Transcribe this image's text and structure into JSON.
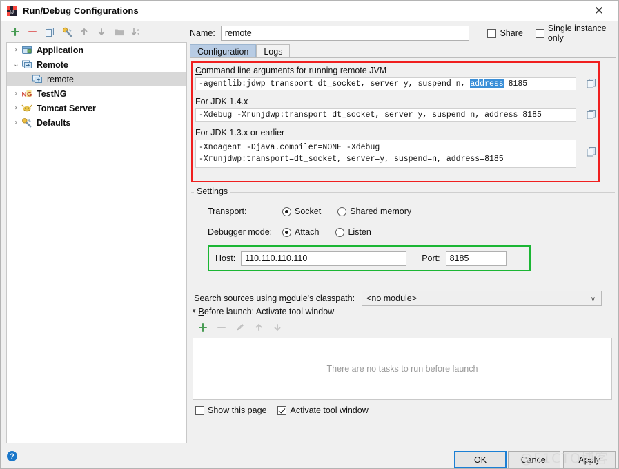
{
  "window": {
    "title": "Run/Debug Configurations",
    "icon": "intellij-idea-icon",
    "close_label": "✕"
  },
  "toolbar": {
    "buttons": [
      {
        "name": "add-button",
        "glyph": "+",
        "color": "#499c54"
      },
      {
        "name": "remove-button",
        "glyph": "−",
        "color": "#d9534f"
      },
      {
        "name": "copy-configuration-button",
        "glyph": "copy-icon",
        "color": "#6b9ec9"
      },
      {
        "name": "edit-templates-button",
        "glyph": "wrench-icon",
        "color": "#d8a22a"
      },
      {
        "name": "move-up-button",
        "glyph": "↑",
        "color": "#a0a0a0"
      },
      {
        "name": "move-down-button",
        "glyph": "↓",
        "color": "#a0a0a0"
      },
      {
        "name": "new-folder-button",
        "glyph": "folder-icon",
        "color": "#a9a9a9"
      },
      {
        "name": "sort-button",
        "glyph": "sort-icon",
        "color": "#a0a0a0"
      }
    ]
  },
  "tree": {
    "items": [
      {
        "label": "Application",
        "arrow": "›",
        "icon": "application-icon",
        "level": 0,
        "selected": false,
        "bold": true
      },
      {
        "label": "Remote",
        "arrow": "⌄",
        "icon": "remote-icon",
        "level": 0,
        "selected": false,
        "bold": true
      },
      {
        "label": "remote",
        "arrow": "",
        "icon": "remote-icon",
        "level": 1,
        "selected": true,
        "bold": false
      },
      {
        "label": "TestNG",
        "arrow": "›",
        "icon": "testng-icon",
        "level": 0,
        "selected": false,
        "bold": true
      },
      {
        "label": "Tomcat Server",
        "arrow": "›",
        "icon": "tomcat-icon",
        "level": 0,
        "selected": false,
        "bold": true
      },
      {
        "label": "Defaults",
        "arrow": "›",
        "icon": "defaults-icon",
        "level": 0,
        "selected": false,
        "bold": true
      }
    ]
  },
  "name_row": {
    "label": "Name:",
    "value": "remote",
    "placeholder": "",
    "share_label": "Share",
    "share_checked": false,
    "single_instance_label": "Single instance only",
    "single_instance_checked": false
  },
  "tabs": [
    {
      "label": "Configuration",
      "active": true
    },
    {
      "label": "Logs",
      "active": false
    }
  ],
  "jvm_args": {
    "border_color": "#f01f1f",
    "sections": [
      {
        "title": "Command line arguments for running remote JVM",
        "value_prefix": "-agentlib:jdwp=transport=dt_socket, server=y, suspend=n, ",
        "value_selected": "address",
        "value_suffix": "=8185",
        "selection_color": "#3a8fd8",
        "copy_icon": "copy-icon"
      },
      {
        "title": "For JDK 1.4.x",
        "value_prefix": "-Xdebug -Xrunjdwp:transport=dt_socket, server=y, suspend=n, address=8185",
        "value_selected": "",
        "value_suffix": "",
        "copy_icon": "copy-icon"
      },
      {
        "title": "For JDK 1.3.x or earlier",
        "line1": "-Xnoagent -Djava.compiler=NONE -Xdebug",
        "line2": "-Xrunjdwp:transport=dt_socket, server=y, suspend=n, address=8185",
        "copy_icon": "copy-icon"
      }
    ]
  },
  "settings": {
    "legend": "Settings",
    "transport": {
      "label": "Transport:",
      "options": [
        {
          "label": "Socket",
          "selected": true
        },
        {
          "label": "Shared memory",
          "selected": false
        }
      ]
    },
    "debugger_mode": {
      "label": "Debugger mode:",
      "options": [
        {
          "label": "Attach",
          "selected": true
        },
        {
          "label": "Listen",
          "selected": false
        }
      ]
    },
    "host_port": {
      "border_color": "#1bb634",
      "host_label": "Host:",
      "host_value": "110.110.110.110",
      "port_label": "Port:",
      "port_value": "8185"
    },
    "classpath": {
      "label": "Search sources using module's classpath:",
      "value": "<no module>",
      "arrow": "∨"
    }
  },
  "before_launch": {
    "triangle": "▾",
    "title": "Before launch: Activate tool window",
    "toolbar": [
      {
        "name": "add-task-button",
        "glyph": "+",
        "color": "#499c54",
        "enabled": true
      },
      {
        "name": "remove-task-button",
        "glyph": "−",
        "color": "#bdbdbd",
        "enabled": false
      },
      {
        "name": "edit-task-button",
        "glyph": "pencil-icon",
        "color": "#bdbdbd",
        "enabled": false
      },
      {
        "name": "move-task-up-button",
        "glyph": "↑",
        "color": "#bdbdbd",
        "enabled": false
      },
      {
        "name": "move-task-down-button",
        "glyph": "↓",
        "color": "#bdbdbd",
        "enabled": false
      }
    ],
    "empty_text": "There are no tasks to run before launch",
    "show_page_label": "Show this page",
    "show_page_checked": false,
    "activate_tool_window_label": "Activate tool window",
    "activate_tool_window_checked": true
  },
  "footer": {
    "help_glyph": "?",
    "ok_label": "OK",
    "cancel_label": "Cancel",
    "apply_label": "Apply",
    "watermark": "@51CTO博客"
  }
}
